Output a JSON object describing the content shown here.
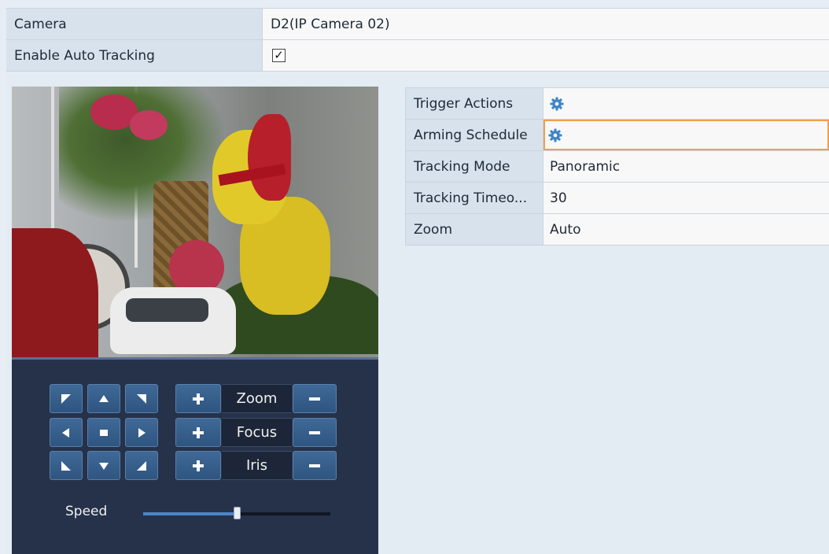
{
  "settings": {
    "camera_label": "Camera",
    "camera_value": "D2(IP Camera 02)",
    "auto_tracking_label": "Enable Auto Tracking",
    "auto_tracking_checked": "✓"
  },
  "tracking": {
    "rows": [
      {
        "label": "Trigger Actions",
        "value": "",
        "icon": "gear-icon"
      },
      {
        "label": "Arming Schedule",
        "value": "",
        "icon": "gear-icon"
      },
      {
        "label": "Tracking Mode",
        "value": "Panoramic"
      },
      {
        "label": "Tracking Timeo...",
        "value": "30"
      },
      {
        "label": "Zoom",
        "value": "Auto"
      }
    ]
  },
  "ptz": {
    "zoom_label": "Zoom",
    "focus_label": "Focus",
    "iris_label": "Iris",
    "speed_label": "Speed",
    "speed_level": 0.5
  },
  "colors": {
    "accent_focus": "#f0a04a",
    "gear_blue": "#3f86c7",
    "panel_bg": "#26324a"
  }
}
